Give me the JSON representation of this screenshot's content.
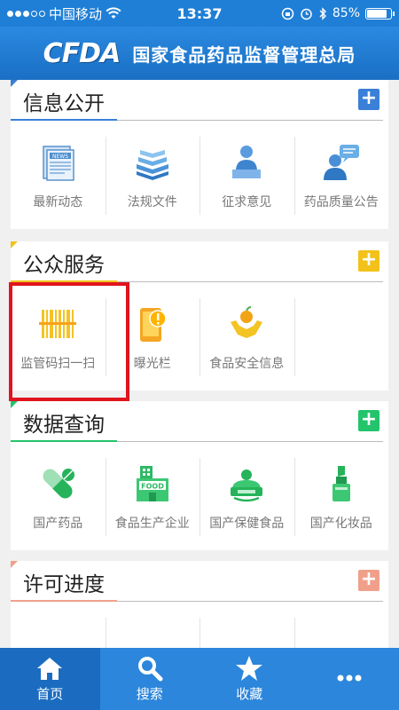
{
  "status_bar": {
    "carrier": "中国移动",
    "time": "13:37",
    "battery": "85%",
    "battery_level": 0.85
  },
  "header": {
    "logo": "CFDA",
    "title": "国家食品药品监督管理总局"
  },
  "sections": [
    {
      "title": "信息公开",
      "color": "#3a7fd8",
      "items": [
        {
          "label": "最新动态",
          "icon": "news-icon"
        },
        {
          "label": "法规文件",
          "icon": "books-icon"
        },
        {
          "label": "征求意见",
          "icon": "person-desk-icon"
        },
        {
          "label": "药品质量公告",
          "icon": "person-speech-icon"
        }
      ]
    },
    {
      "title": "公众服务",
      "color": "#f2c21a",
      "items": [
        {
          "label": "监管码扫一扫",
          "icon": "barcode-icon"
        },
        {
          "label": "曝光栏",
          "icon": "exposure-phone-icon"
        },
        {
          "label": "食品安全信息",
          "icon": "hands-apple-icon"
        }
      ]
    },
    {
      "title": "数据查询",
      "color": "#23c46b",
      "items": [
        {
          "label": "国产药品",
          "icon": "capsule-icon"
        },
        {
          "label": "食品生产企业",
          "icon": "food-factory-icon"
        },
        {
          "label": "国产保健食品",
          "icon": "health-food-icon"
        },
        {
          "label": "国产化妆品",
          "icon": "cosmetics-icon"
        }
      ]
    },
    {
      "title": "许可进度",
      "color": "#f0a08a",
      "items": []
    }
  ],
  "tabs": [
    {
      "label": "首页",
      "icon": "home-icon",
      "active": true
    },
    {
      "label": "搜索",
      "icon": "search-icon",
      "active": false
    },
    {
      "label": "收藏",
      "icon": "star-icon",
      "active": false
    },
    {
      "label": "",
      "icon": "more-icon",
      "active": false
    }
  ]
}
